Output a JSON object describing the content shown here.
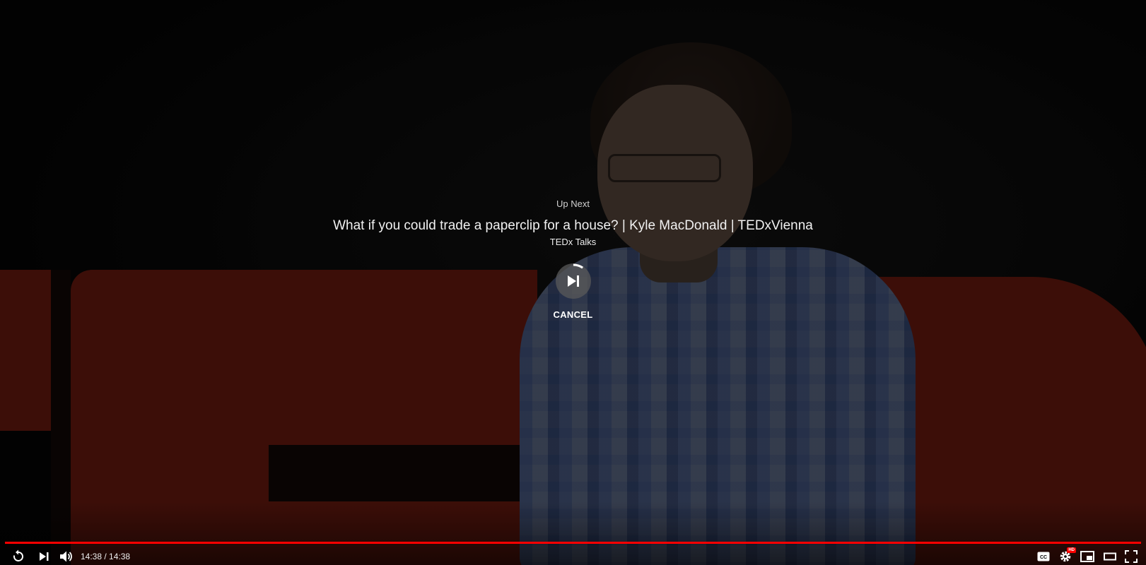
{
  "up_next": {
    "label": "Up Next",
    "title": "What if you could trade a paperclip for a house? | Kyle MacDonald | TEDxVienna",
    "channel": "TEDx Talks",
    "cancel_label": "CANCEL"
  },
  "player": {
    "current_time": "14:38",
    "duration": "14:38",
    "time_display": "14:38 / 14:38",
    "progress_fraction": 1.0,
    "hd_badge": "HD"
  },
  "controls": {
    "left": [
      "replay-icon",
      "next-icon",
      "volume-icon"
    ],
    "right": [
      "subtitles-icon",
      "settings-icon",
      "miniplayer-icon",
      "theater-mode-icon",
      "fullscreen-icon"
    ]
  },
  "colors": {
    "progress": "#ff0000",
    "ted_red": "#6e1a0f"
  }
}
